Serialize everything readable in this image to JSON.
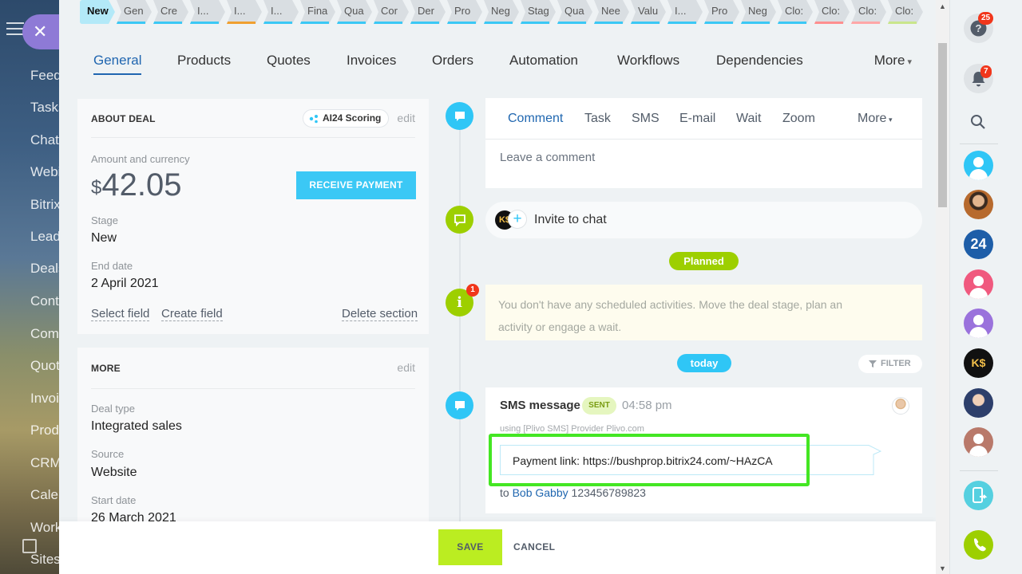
{
  "stages": [
    {
      "label": "New",
      "active": true,
      "color": "#b3e9f8"
    },
    {
      "label": "Gen",
      "color": "#3bc8f5"
    },
    {
      "label": "Cre",
      "color": "#3bc8f5"
    },
    {
      "label": "I...",
      "color": "#3bc8f5"
    },
    {
      "label": "I...",
      "color": "#f0a030"
    },
    {
      "label": "I...",
      "color": "#3bc8f5"
    },
    {
      "label": "Fina",
      "color": "#3bc8f5"
    },
    {
      "label": "Qua",
      "color": "#3bc8f5"
    },
    {
      "label": "Cor",
      "color": "#3bc8f5"
    },
    {
      "label": "Der",
      "color": "#3bc8f5"
    },
    {
      "label": "Pro",
      "color": "#3bc8f5"
    },
    {
      "label": "Neg",
      "color": "#3bc8f5"
    },
    {
      "label": "Stag",
      "color": "#3bc8f5"
    },
    {
      "label": "Qua",
      "color": "#3bc8f5"
    },
    {
      "label": "Nee",
      "color": "#3bc8f5"
    },
    {
      "label": "Valu",
      "color": "#3bc8f5"
    },
    {
      "label": "I...",
      "color": "#3bc8f5"
    },
    {
      "label": "Pro",
      "color": "#3bc8f5"
    },
    {
      "label": "Neg",
      "color": "#3bc8f5"
    },
    {
      "label": "Clo:",
      "color": "#3bc8f5"
    },
    {
      "label": "Clo:",
      "color": "#ff8f8f"
    },
    {
      "label": "Clo:",
      "color": "#ffa7a7"
    },
    {
      "label": "Clo:",
      "color": "#c9e68c"
    }
  ],
  "tabs": [
    "General",
    "Products",
    "Quotes",
    "Invoices",
    "Orders",
    "Automation",
    "Workflows",
    "Dependencies"
  ],
  "tabs_more": "More",
  "about": {
    "title": "ABOUT DEAL",
    "badge": "AI24 Scoring",
    "edit": "edit",
    "amount_label": "Amount and currency",
    "currency": "$",
    "amount": "42.05",
    "receive_payment": "RECEIVE PAYMENT",
    "stage_label": "Stage",
    "stage_value": "New",
    "end_label": "End date",
    "end_value": "2 April 2021",
    "select_field": "Select field",
    "create_field": "Create field",
    "delete_section": "Delete section"
  },
  "more_card": {
    "title": "MORE",
    "edit": "edit",
    "type_label": "Deal type",
    "type_value": "Integrated sales",
    "source_label": "Source",
    "source_value": "Website",
    "start_label": "Start date",
    "start_value": "26 March 2021"
  },
  "comment_tabs": [
    "Comment",
    "Task",
    "SMS",
    "E-mail",
    "Wait",
    "Zoom"
  ],
  "comment_more": "More",
  "comment_placeholder": "Leave a comment",
  "chat": {
    "avatar_text": "K$",
    "plus": "+",
    "text": "Invite to chat"
  },
  "planned": "Planned",
  "notice_badge": "1",
  "notice": "You don't have any scheduled activities. Move the deal stage, plan an activity or engage a wait.",
  "today": "today",
  "filter": "FILTER",
  "sms": {
    "title": "SMS message",
    "status": "SENT",
    "time": "04:58 pm",
    "provider": "using [Plivo SMS] Provider Plivo.com",
    "message": "Payment link: https://bushprop.bitrix24.com/~HAzCA",
    "to_prefix": "to",
    "contact": "Bob Gabby",
    "phone": "123456789823"
  },
  "footer": {
    "save": "SAVE",
    "cancel": "CANCEL"
  },
  "left_menu": [
    "Feed",
    "Tasks",
    "Chat",
    "Webinars",
    "Bitrix",
    "Leads",
    "Deals",
    "Contacts",
    "Companies",
    "Quotes",
    "Invoices",
    "Products",
    "CRM",
    "Calendar",
    "Workgroups",
    "Sites"
  ],
  "right_bar": {
    "help_badge": "25",
    "notif_badge": "7",
    "logo_text": "24",
    "contact_text": "K$"
  }
}
